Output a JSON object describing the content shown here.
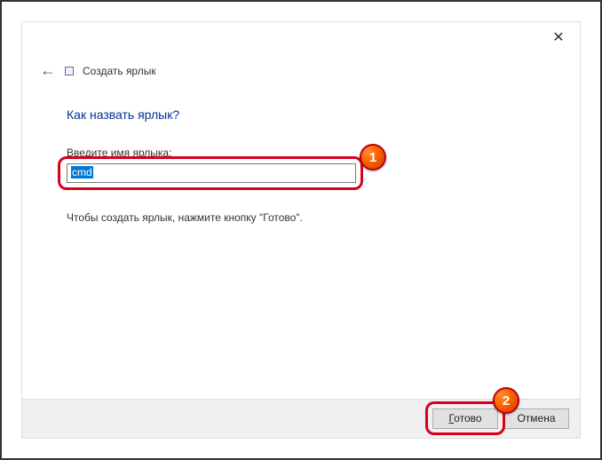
{
  "window": {
    "close": "✕"
  },
  "header": {
    "back": "←",
    "title": "Создать ярлык"
  },
  "page": {
    "heading": "Как назвать ярлык?",
    "label": "Введите имя ярлыка:",
    "value": "cmd",
    "instruction": "Чтобы создать ярлык, нажмите кнопку \"Готово\"."
  },
  "footer": {
    "finish_mnemonic": "Г",
    "finish_rest": "отово",
    "cancel": "Отмена"
  },
  "annotations": {
    "one": "1",
    "two": "2"
  }
}
